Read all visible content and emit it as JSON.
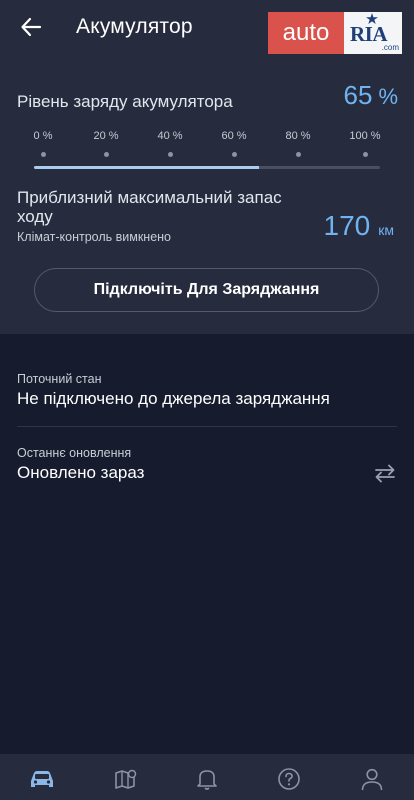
{
  "header": {
    "title": "Акумулятор",
    "back_icon": "arrow-left-icon",
    "logo": {
      "part1": "auto",
      "part2": "RIA",
      "suffix": ".com",
      "accent": "#d9534c"
    }
  },
  "battery": {
    "label": "Рівень заряду акумулятора",
    "value": "65",
    "unit": "%",
    "level_fraction": 0.65,
    "scale_ticks": [
      "0 %",
      "20 %",
      "40 %",
      "60 %",
      "80 %",
      "100 %"
    ]
  },
  "range": {
    "label": "Приблизний максимальний запас ходу",
    "subtitle": "Клімат-контроль вимкнено",
    "value": "170",
    "unit": "км"
  },
  "connect_button": {
    "label": "Підключіть Для Заряджання"
  },
  "status": {
    "title": "Поточний стан",
    "value": "Не підключено до джерела заряджання"
  },
  "last_update": {
    "title": "Останнє оновлення",
    "value": "Оновлено зараз",
    "icon": "refresh-icon"
  },
  "bottom_nav": [
    "car-icon",
    "map-icon",
    "bell-icon",
    "help-icon",
    "profile-icon"
  ],
  "colors": {
    "accent_value": "#6fb3f2",
    "panel": "#262c3d",
    "background": "#161c2e"
  }
}
